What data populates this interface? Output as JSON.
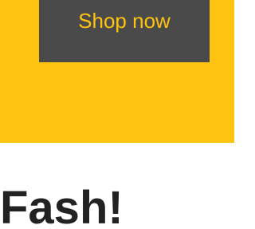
{
  "banner": {
    "background_color": "#fec210",
    "cta_label": "Shop now",
    "cta_background_color": "#4a4a4a",
    "cta_text_color": "#fec210"
  },
  "section": {
    "heading": "Fash!",
    "heading_color": "#222222"
  }
}
